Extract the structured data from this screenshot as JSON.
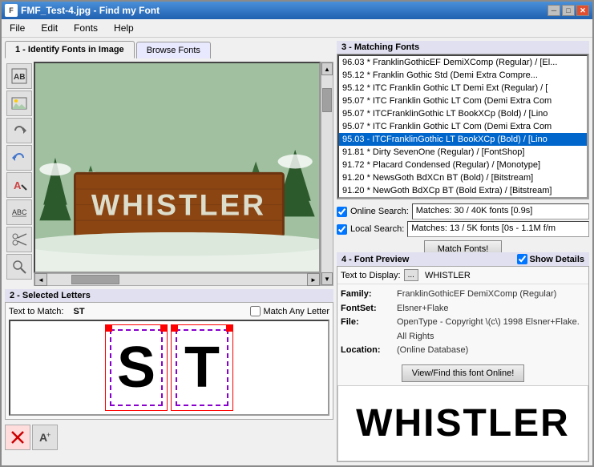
{
  "window": {
    "title": "FMF_Test-4.jpg - Find my Font",
    "icon": "F"
  },
  "menu": {
    "items": [
      "File",
      "Edit",
      "Fonts",
      "Help"
    ]
  },
  "tabs": {
    "tab1": "1 - Identify Fonts in Image",
    "tab2": "Browse Fonts"
  },
  "matching_fonts": {
    "title": "3 - Matching Fonts",
    "items": [
      {
        "score": "96.03",
        "star": true,
        "name": "FranklinGothicEF DemiXComp (Regular) / [El...",
        "highlight": false
      },
      {
        "score": "95.12",
        "star": true,
        "name": "Franklin Gothic Std (Demi Extra Compre...",
        "highlight": false
      },
      {
        "score": "95.12",
        "star": true,
        "name": "ITC Franklin Gothic LT Demi Ext (Regular) / [",
        "highlight": false
      },
      {
        "score": "95.07",
        "star": true,
        "name": "ITC Franklin Gothic LT Com (Demi Extra Com",
        "highlight": false
      },
      {
        "score": "95.07",
        "star": true,
        "name": "ITCFranklinGothic LT BookXCp (Bold) / [Lino",
        "highlight": false
      },
      {
        "score": "95.07",
        "star": true,
        "name": "ITC Franklin Gothic LT Com (Demi Extra Com",
        "highlight": false
      },
      {
        "score": "95.03",
        "star": true,
        "name": "ITCFranklinGothic LT BookXCp (Bold) / [Lino",
        "highlight": true,
        "selected": true
      },
      {
        "score": "91.81",
        "star": true,
        "name": "Dirty SevenOne (Regular) / [FontShop]",
        "highlight": false
      },
      {
        "score": "91.72",
        "star": true,
        "name": "Placard Condensed (Regular) / [Monotype]",
        "highlight": false
      },
      {
        "score": "91.20",
        "star": true,
        "name": "NewsGoth BdXCn BT (Bold) / [Bitstream]",
        "highlight": false
      },
      {
        "score": "91.20",
        "star": true,
        "name": "NewGoth BdXCp BT (Bold Extra) / [Bitstream]",
        "highlight": false
      }
    ]
  },
  "online_search": {
    "label": "Online Search:",
    "result": "Matches: 30 / 40K fonts [0.9s]",
    "checked": true
  },
  "local_search": {
    "label": "Local Search:",
    "result": "Matches: 13 / 5K fonts [0s - 1.1M f/m",
    "checked": true
  },
  "match_button": "Match Fonts!",
  "selected_letters": {
    "title": "2 - Selected Letters",
    "text_to_match_label": "Text to Match:",
    "text_to_match_value": "ST",
    "match_any_label": "Match Any Letter",
    "letters": [
      "S",
      "T"
    ]
  },
  "font_preview": {
    "title": "4 - Font Preview",
    "show_details_label": "Show Details",
    "text_to_display_label": "Text to Display:",
    "text_to_display_dots": "...",
    "text_to_display_value": "WHISTLER",
    "family_label": "Family:",
    "family_value": "FranklinGothicEF DemiXComp (Regular)",
    "fontset_label": "FontSet:",
    "fontset_value": "Elsner+Flake",
    "file_label": "File:",
    "file_value": "OpenType - Copyright \\(c\\) 1998 Elsner+Flake. All Rights",
    "location_label": "Location:",
    "location_value": "(Online Database)",
    "view_button": "View/Find this font Online!",
    "preview_text": "WHISTLER"
  }
}
